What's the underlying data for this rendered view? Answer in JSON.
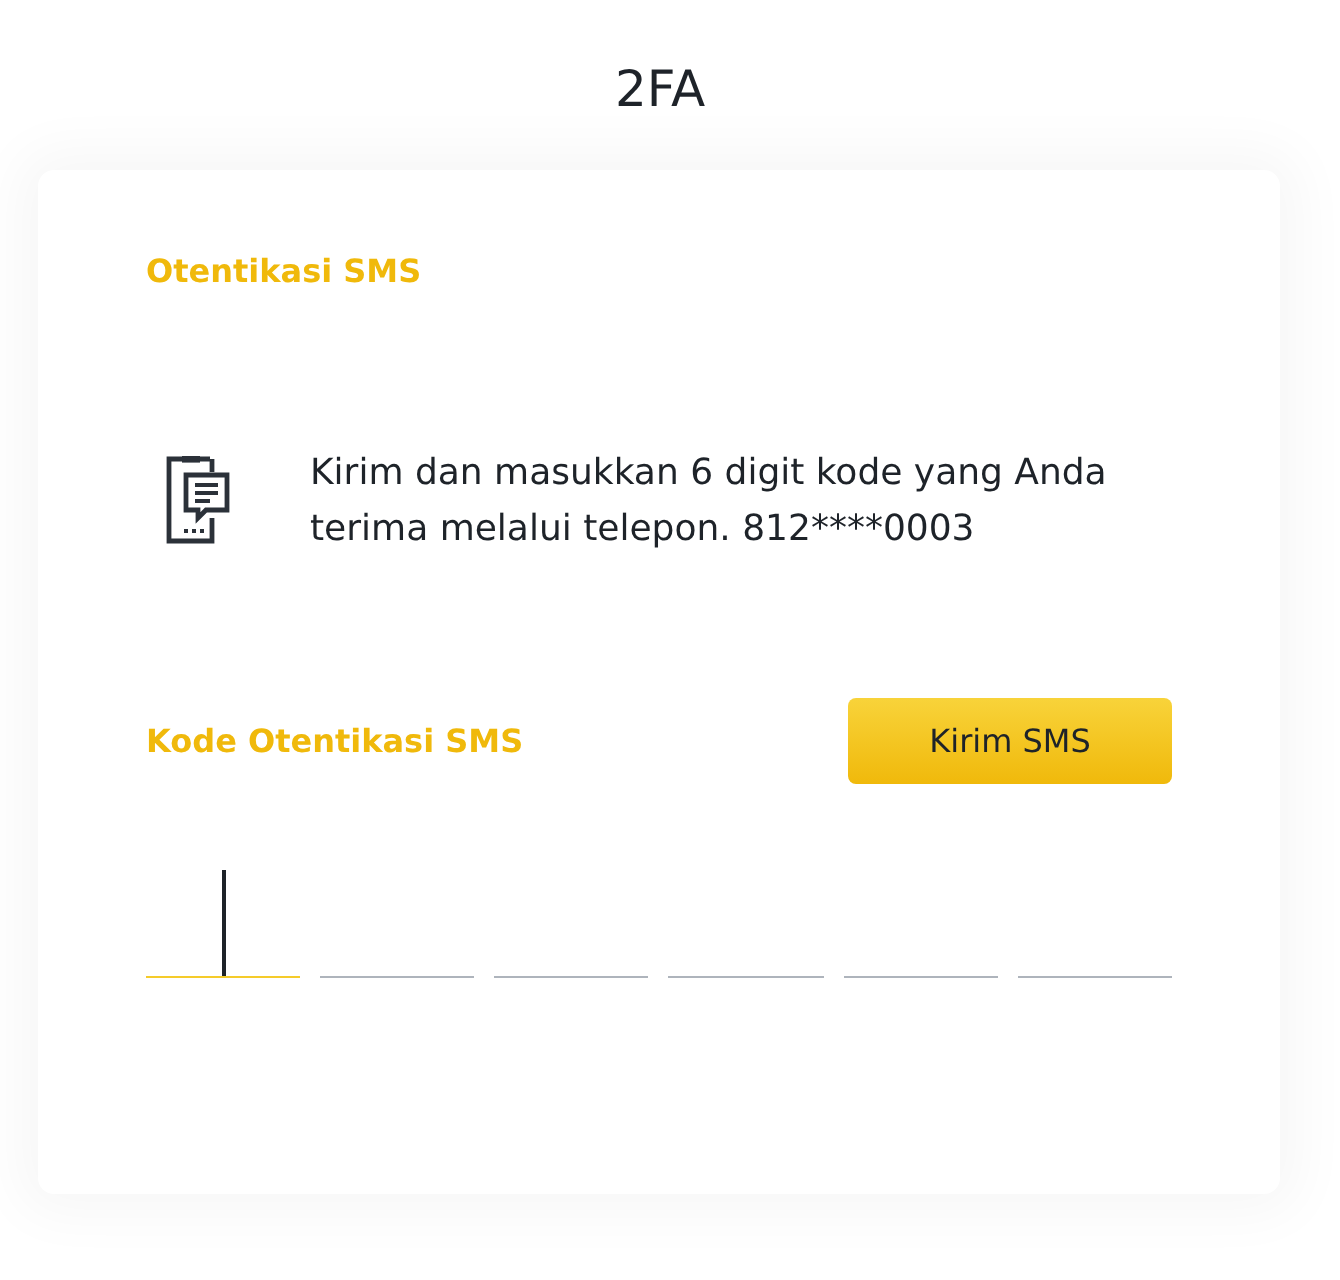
{
  "page": {
    "title": "2FA"
  },
  "card": {
    "heading": "Otentikasi SMS",
    "description": "Kirim dan masukkan 6 digit kode yang Anda terima melalui telepon. 812****0003",
    "code_label": "Kode Otentikasi SMS",
    "send_button": "Kirim SMS",
    "code_inputs": [
      {
        "focused": true
      },
      {
        "focused": false
      },
      {
        "focused": false
      },
      {
        "focused": false
      },
      {
        "focused": false
      },
      {
        "focused": false
      }
    ]
  }
}
